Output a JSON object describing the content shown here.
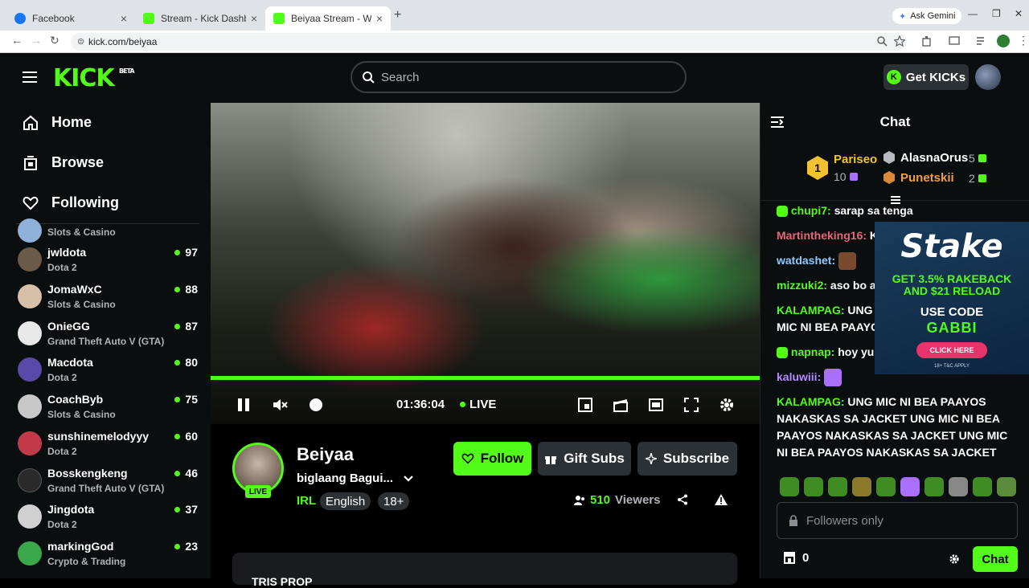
{
  "browser": {
    "tabs": [
      {
        "title": "Facebook",
        "favicon": "facebook-icon"
      },
      {
        "title": "Stream - Kick Dashboard",
        "favicon": "kick-icon"
      },
      {
        "title": "Beiyaa Stream - Watch Live on",
        "favicon": "kick-icon"
      }
    ],
    "active_tab": 2,
    "ask_gemini": "Ask Gemini",
    "url": "kick.com/beiyaa"
  },
  "header": {
    "logo": "KICK",
    "logo_badge": "BETA",
    "search_placeholder": "Search",
    "get_kicks": "Get KICKs"
  },
  "sidebar": {
    "nav": [
      {
        "label": "Home",
        "icon": "home-icon"
      },
      {
        "label": "Browse",
        "icon": "browse-icon"
      },
      {
        "label": "Following",
        "icon": "heart-icon"
      }
    ],
    "partial_category": "Slots & Casino",
    "channels": [
      {
        "name": "jwldota",
        "category": "Dota 2",
        "viewers": "97"
      },
      {
        "name": "JomaWxC",
        "category": "Slots & Casino",
        "viewers": "88"
      },
      {
        "name": "OnieGG",
        "category": "Grand Theft Auto V (GTA)",
        "viewers": "87"
      },
      {
        "name": "Macdota",
        "category": "Dota 2",
        "viewers": "80"
      },
      {
        "name": "CoachByb",
        "category": "Slots & Casino",
        "viewers": "75"
      },
      {
        "name": "sunshinemelodyyy",
        "category": "Dota 2",
        "viewers": "60"
      },
      {
        "name": "Bosskengkeng",
        "category": "Grand Theft Auto V (GTA)",
        "viewers": "46"
      },
      {
        "name": "Jingdota",
        "category": "Dota 2",
        "viewers": "37"
      },
      {
        "name": "markingGod",
        "category": "Crypto & Trading",
        "viewers": "23"
      }
    ]
  },
  "player": {
    "elapsed": "01:36:04",
    "live_label": "LIVE",
    "progress": 1.0
  },
  "stream": {
    "streamer": "Beiyaa",
    "live_badge": "LIVE",
    "title": "biglaang Bagui...",
    "category": "IRL",
    "tags": [
      "English",
      "18+"
    ],
    "follow": "Follow",
    "gift_subs": "Gift Subs",
    "subscribe": "Subscribe",
    "viewers_count": "510",
    "viewers_label": "Viewers",
    "panel_heading": "TRIS PROP"
  },
  "chat": {
    "title": "Chat",
    "leaderboard": {
      "first": {
        "name": "Pariseo",
        "count": "10"
      },
      "second": {
        "name": "AlasnaOrus",
        "count": "5"
      },
      "third": {
        "name": "Punetskii",
        "count": "2"
      }
    },
    "messages": [
      {
        "user": "chupi7:",
        "text": "sarap sa tenga",
        "color": "#53fc18"
      },
      {
        "user": "Martintheking16:",
        "text": "KA",
        "color": "#e8667a"
      },
      {
        "user": "watdashet:",
        "text": "",
        "color": "#8ec8ff"
      },
      {
        "user": "mizzuki2:",
        "text": "aso bo ay",
        "color": "#53fc18"
      },
      {
        "user": "KALAMPAG:",
        "text": "UNG M",
        "color": "#53fc18"
      },
      {
        "user": "",
        "text": "MIC NI BEA PAAYOS",
        "color": "#53fc18"
      },
      {
        "user": "napnap:",
        "text": "hoy yur",
        "color": "#53fc18"
      },
      {
        "user": "kaluwiii:",
        "text": "",
        "color": "#b28cff"
      },
      {
        "user": "KALAMPAG:",
        "text": "UNG MIC NI BEA PAAYOS NAKASKAS SA JACKET UNG MIC NI BEA PAAYOS NAKASKAS SA JACKET UNG MIC NI BEA PAAYOS NAKASKAS SA JACKET",
        "color": "#53fc18"
      }
    ],
    "input_placeholder": "Followers only",
    "kicks_balance": "0",
    "send_label": "Chat"
  },
  "ad": {
    "brand": "Stake",
    "line1": "GET 3.5% RAKEBACK",
    "line2": "AND $21 RELOAD",
    "use_code": "USE CODE",
    "code": "GABBI",
    "cta": "CLICK HERE",
    "tc": "18+ T&C APPLY"
  }
}
